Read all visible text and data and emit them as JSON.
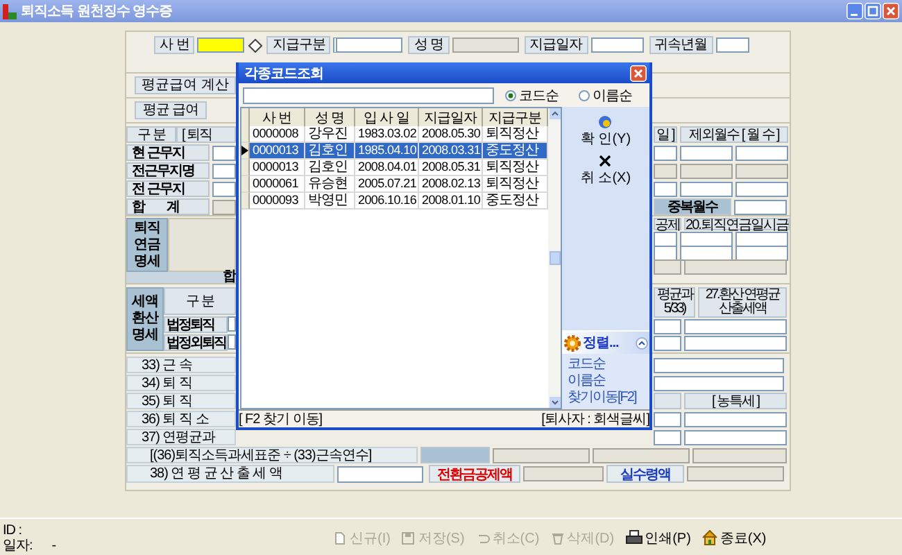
{
  "window": {
    "title": "퇴직소득 원천징수 영수증"
  },
  "header": {
    "row1": [
      {
        "label": "사 번",
        "kind": "key"
      },
      {
        "label": "지급구분",
        "kind": "code"
      },
      {
        "label": "성 명",
        "kind": "readonly"
      },
      {
        "label": "지급일자",
        "kind": "text"
      },
      {
        "label": "귀속년월",
        "kind": "short"
      }
    ]
  },
  "calc_button": "평균급여 계산",
  "average_label": "평균 급여",
  "work_table": {
    "header_left": [
      "구 분",
      "[ 퇴직"
    ],
    "header_right": [
      "일 ]",
      "제외월수 [ 월 수 ]"
    ],
    "rows": [
      {
        "label": "현 근무지",
        "kind": "entry"
      },
      {
        "label": "전근무지명",
        "kind": "name"
      },
      {
        "label": "전 근무지",
        "kind": "entry"
      },
      {
        "label": "합 계",
        "kind": "total",
        "right_label": "중복월수"
      }
    ]
  },
  "pension": {
    "title": "퇴직 연금 명세",
    "header_right": [
      "공제",
      "20.퇴직연금일시금"
    ],
    "rows": [
      {
        "kind": "entry"
      },
      {
        "kind": "entry"
      },
      {
        "kind": "sum"
      }
    ],
    "total_label": "합"
  },
  "tax": {
    "title": "세액 환산 명세",
    "column_label": "구 분",
    "header_right": [
      "평균과 5/33)",
      "27.환산 연평균 산출세액"
    ],
    "rows": [
      {
        "label": "법정퇴직"
      },
      {
        "label": "법정외퇴직"
      }
    ]
  },
  "calc_rows": [
    {
      "label": "33) 근 속",
      "kind": "single"
    },
    {
      "label": "34) 퇴 직",
      "kind": "single"
    },
    {
      "label": "35) 퇴 직",
      "kind": "header",
      "right": "[ 농특세 ]"
    },
    {
      "label": "36) 퇴 직 소",
      "kind": "double"
    },
    {
      "label": "37) 연평균과",
      "kind": "double"
    }
  ],
  "formula": "[(36)퇴직소득과세표준 ÷ (33)근속연수]",
  "final_row": {
    "label": "38) 연 평 균 산 출 세 액",
    "deduction_label": "전환금공제액",
    "net_label": "실수령액"
  },
  "code_dialog": {
    "title": "각종코드조회",
    "sort_options": [
      {
        "label": "코드순",
        "selected": true
      },
      {
        "label": "이름순",
        "selected": false
      }
    ],
    "columns": [
      "사 번",
      "성 명",
      "입 사 일",
      "지급일자",
      "지급구분"
    ],
    "rows": [
      {
        "cells": [
          "0000008",
          "강우진",
          "1983.03.02",
          "2008.05.30",
          "퇴직정산"
        ],
        "selected": false
      },
      {
        "cells": [
          "0000013",
          "김호인",
          "1985.04.10",
          "2008.03.31",
          "중도정산"
        ],
        "selected": true
      },
      {
        "cells": [
          "0000013",
          "김호인",
          "2008.04.01",
          "2008.05.31",
          "퇴직정산"
        ],
        "selected": false
      },
      {
        "cells": [
          "0000061",
          "유승현",
          "2005.07.21",
          "2008.02.13",
          "퇴직정산"
        ],
        "selected": false
      },
      {
        "cells": [
          "0000093",
          "박영민",
          "2006.10.16",
          "2008.01.10",
          "중도정산"
        ],
        "selected": false
      }
    ],
    "actions": [
      {
        "label": "확 인(Y)",
        "kind": "ok"
      },
      {
        "label": "취 소(X)",
        "kind": "cancel"
      }
    ],
    "task_panel": {
      "title": "정렬...",
      "expanded": true,
      "links": [
        "코드순",
        "이름순",
        "찾기이동[F2]"
      ]
    },
    "status_left": "[ F2 찾기 이동]",
    "status_right": "[퇴사자 : 회색글씨]"
  },
  "toolbar": [
    {
      "label": "신규(I)",
      "kind": "new",
      "disabled": true
    },
    {
      "label": "저장(S)",
      "kind": "save",
      "disabled": true
    },
    {
      "label": "취소(C)",
      "kind": "undo",
      "disabled": true
    },
    {
      "label": "삭제(D)",
      "kind": "delete",
      "disabled": true
    },
    {
      "label": "인쇄(P)",
      "kind": "print",
      "disabled": false
    },
    {
      "label": "종료(X)",
      "kind": "exit",
      "disabled": false
    }
  ],
  "status": {
    "id_label": "ID :",
    "date_label": "일자:",
    "date_value": "-"
  }
}
